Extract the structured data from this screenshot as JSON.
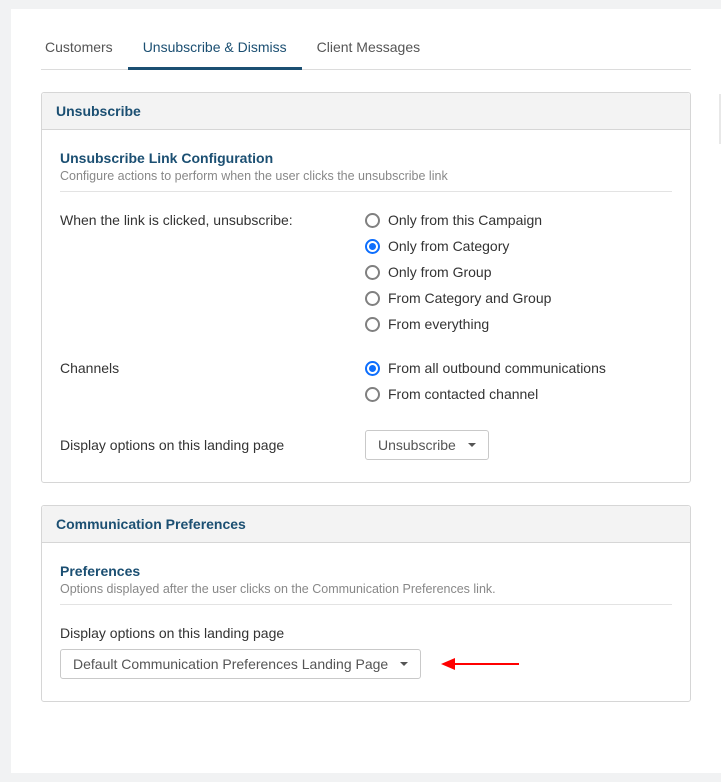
{
  "tabs": {
    "customers": "Customers",
    "unsub": "Unsubscribe & Dismiss",
    "client": "Client Messages"
  },
  "unsub_panel": {
    "title": "Unsubscribe",
    "section_title": "Unsubscribe Link Configuration",
    "section_subtitle": "Configure actions to perform when the user clicks the unsubscribe link",
    "when_label": "When the link is clicked, unsubscribe:",
    "when_options": {
      "campaign": "Only from this Campaign",
      "category": "Only from Category",
      "group": "Only from Group",
      "cat_group": "From Category and Group",
      "everything": "From everything"
    },
    "channels_label": "Channels",
    "channels_options": {
      "all": "From all outbound communications",
      "contacted": "From contacted channel"
    },
    "display_label": "Display options on this landing page",
    "display_dropdown": "Unsubscribe"
  },
  "comm_panel": {
    "title": "Communication Preferences",
    "section_title": "Preferences",
    "section_subtitle": "Options displayed after the user clicks on the Communication Preferences link.",
    "display_label": "Display options on this landing page",
    "display_dropdown": "Default Communication Preferences Landing Page"
  }
}
